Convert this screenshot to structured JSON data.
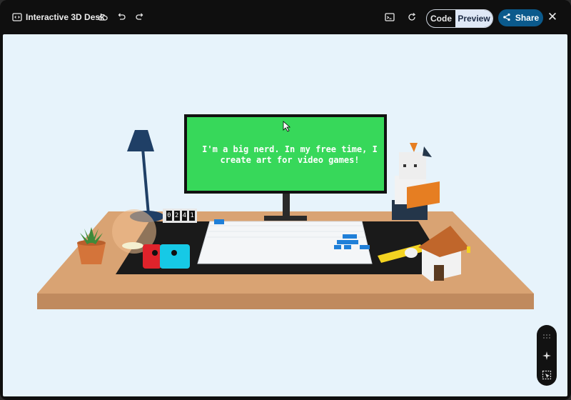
{
  "header": {
    "app_icon": "code-embed-icon",
    "title": "Interactive 3D Desk",
    "actions": [
      "cloud-icon",
      "undo-icon",
      "redo-icon"
    ],
    "right_icons": [
      "terminal-icon",
      "refresh-icon"
    ],
    "tabs": [
      {
        "label": "Code",
        "selected": false
      },
      {
        "label": "Preview",
        "selected": true
      }
    ],
    "share_label": "Share",
    "close_icon": "close-icon"
  },
  "scene": {
    "monitor_text": [
      "I'm a big nerd. In my free time, I",
      "create art for video games!"
    ],
    "counter_digits": [
      "0",
      "2",
      "4",
      "1"
    ],
    "colors": {
      "background": "#e7f3fb",
      "desk": "#d9a373",
      "mat": "#1a1a1a",
      "screen": "#37d85a",
      "lamp": "#1f3f66",
      "controller_left": "#e0232b",
      "controller_right": "#16c9e6",
      "keys": "#1f7fd8"
    }
  },
  "floating_toolbar": {
    "items": [
      "drag-handle-icon",
      "sparkle-icon",
      "select-element-icon"
    ]
  }
}
